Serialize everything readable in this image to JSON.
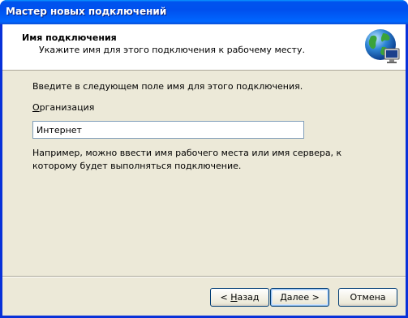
{
  "window": {
    "title": "Мастер новых подключений"
  },
  "header": {
    "title": "Имя подключения",
    "subtitle": "Укажите имя для этого подключения к рабочему месту."
  },
  "content": {
    "instruction": "Введите в следующем поле имя для этого подключения.",
    "field_label_mnemonic": "О",
    "field_label_rest": "рганизация",
    "field_value": "Интернет",
    "hint": "Например, можно ввести имя рабочего места или имя сервера, к которому будет выполняться подключение."
  },
  "buttons": {
    "back": {
      "prefix": "< ",
      "mnemonic": "Н",
      "rest": "азад"
    },
    "next": {
      "mnemonic": "Д",
      "rest": "алее >"
    },
    "cancel": "Отмена"
  },
  "colors": {
    "titlebar": "#0053ee",
    "dialog_bg": "#ece9d8",
    "header_bg": "#ffffff"
  },
  "icons": {
    "header": "globe-network-icon"
  }
}
